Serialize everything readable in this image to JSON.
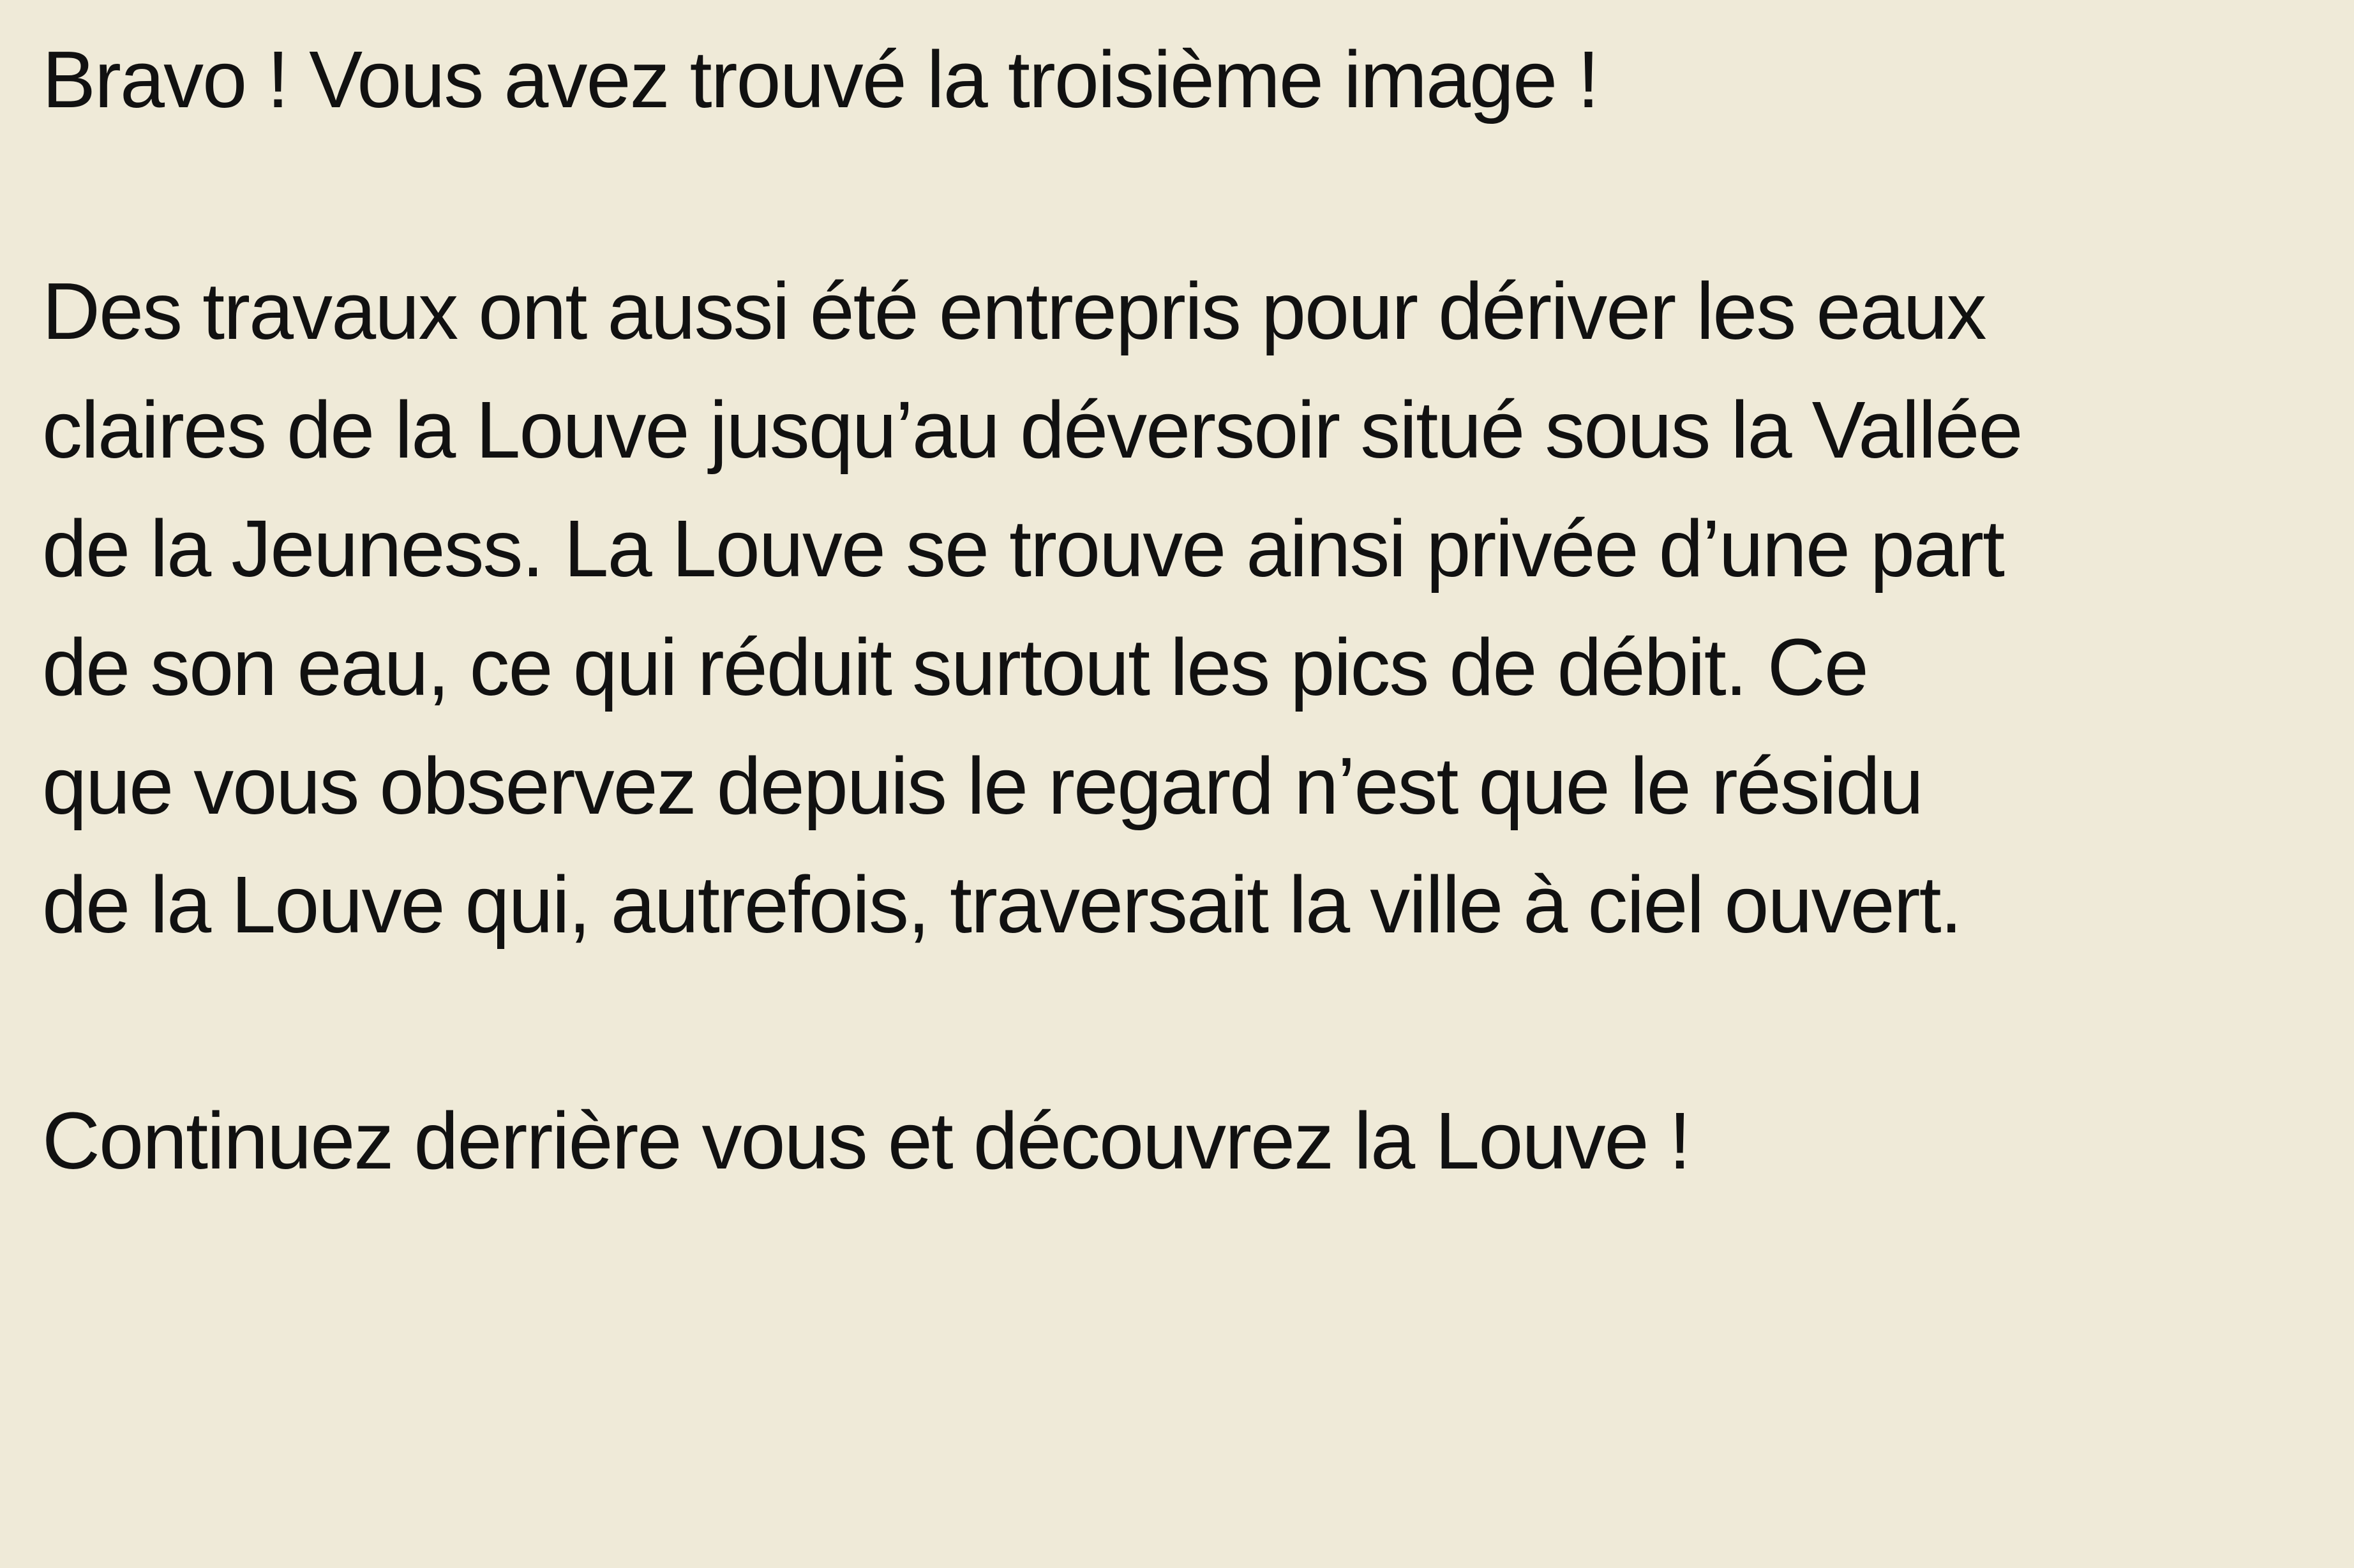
{
  "document": {
    "title": "Bravo ! Vous avez trouvé la troisième image !",
    "paragraph_lines": [
      "Des travaux ont aussi été entrepris pour dériver les eaux",
      "claires de la Louve jusqu’au déversoir situé sous la Vallée",
      "de la Jeuness. La Louve se trouve ainsi privée d’une part",
      "de son eau, ce qui réduit surtout les pics de débit. Ce",
      "que vous observez depuis le regard n’est que le résidu",
      "de la Louve qui, autrefois, traversait la ville à ciel ouvert."
    ],
    "closing": "Continuez derrière vous et découvrez la Louve !"
  },
  "colors": {
    "background": "#EFEAD8",
    "text": "#111111"
  }
}
